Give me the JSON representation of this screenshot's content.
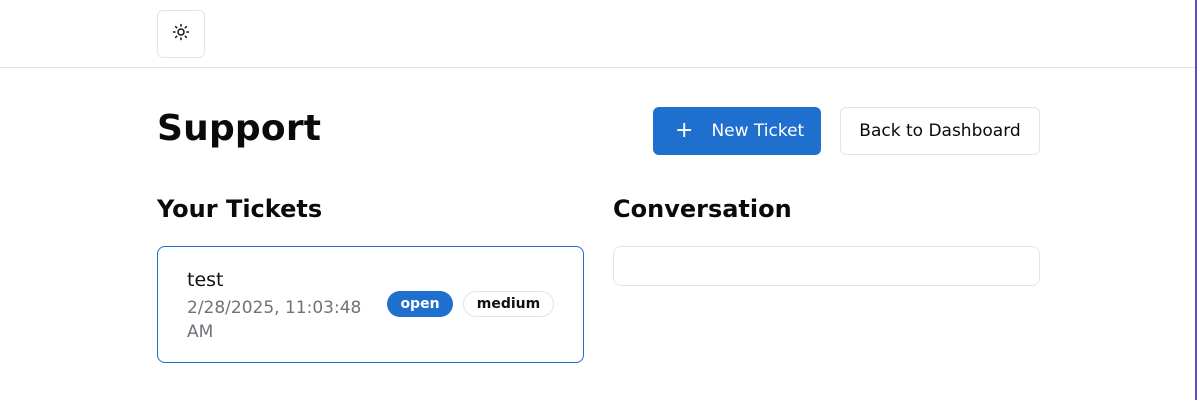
{
  "header": {
    "theme_toggle_icon": "sun-icon"
  },
  "page": {
    "title": "Support"
  },
  "actions": {
    "new_ticket_label": "New Ticket",
    "new_ticket_icon": "plus-icon",
    "back_label": "Back to Dashboard"
  },
  "tickets": {
    "heading": "Your Tickets",
    "items": [
      {
        "subject": "test",
        "date": "2/28/2025, 11:03:48 AM",
        "status": "open",
        "priority": "medium"
      }
    ]
  },
  "conversation": {
    "heading": "Conversation"
  },
  "colors": {
    "accent": "#1f6fcf",
    "border": "#e4e4e7",
    "muted_text": "#71717a"
  }
}
